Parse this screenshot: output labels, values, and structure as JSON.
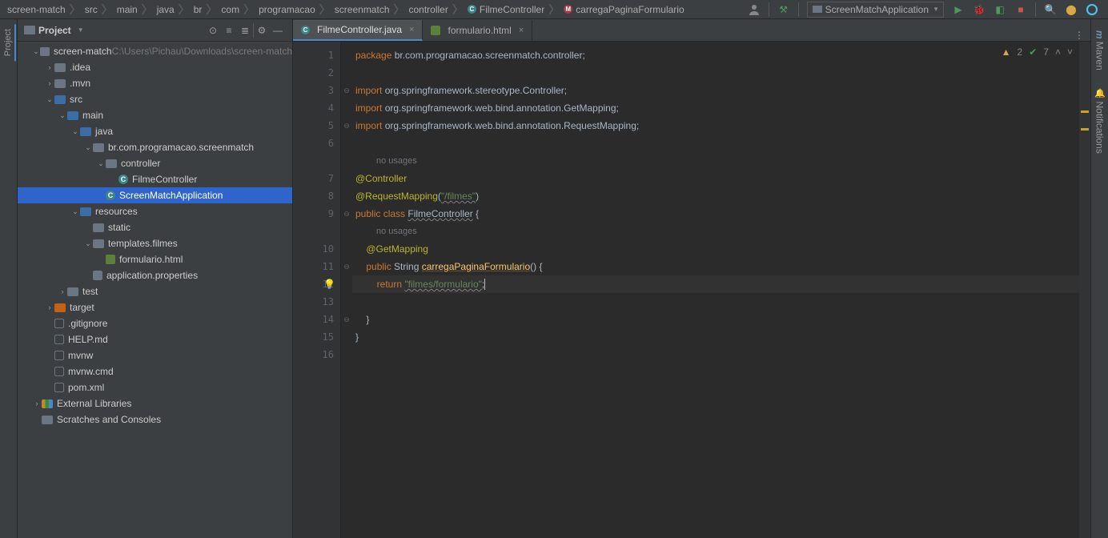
{
  "breadcrumb": [
    "screen-match",
    "src",
    "main",
    "java",
    "br",
    "com",
    "programacao",
    "screenmatch",
    "controller",
    "FilmeController",
    "carregaPaginaFormulario"
  ],
  "breadcrumb_icons": {
    "9": "c",
    "10": "m"
  },
  "run_config": "ScreenMatchApplication",
  "project_label": "Project",
  "tree": [
    {
      "d": 0,
      "a": "v",
      "ic": "folder",
      "t": "screen-match",
      "extra": "C:\\Users\\Pichau\\Downloads\\screen-match"
    },
    {
      "d": 1,
      "a": ">",
      "ic": "folder",
      "t": ".idea"
    },
    {
      "d": 1,
      "a": ">",
      "ic": "folder",
      "t": ".mvn"
    },
    {
      "d": 1,
      "a": "v",
      "ic": "folder-src",
      "t": "src"
    },
    {
      "d": 2,
      "a": "v",
      "ic": "folder-src",
      "t": "main"
    },
    {
      "d": 3,
      "a": "v",
      "ic": "folder-src",
      "t": "java"
    },
    {
      "d": 4,
      "a": "v",
      "ic": "pkg",
      "t": "br.com.programacao.screenmatch"
    },
    {
      "d": 5,
      "a": "v",
      "ic": "pkg",
      "t": "controller"
    },
    {
      "d": 6,
      "a": "",
      "ic": "cfile",
      "ici": "C",
      "t": "FilmeController"
    },
    {
      "d": 5,
      "a": "",
      "ic": "cfile",
      "ici": "C",
      "t": "ScreenMatchApplication",
      "sel": true
    },
    {
      "d": 3,
      "a": "v",
      "ic": "folder-res",
      "t": "resources"
    },
    {
      "d": 4,
      "a": "",
      "ic": "folder",
      "t": "static"
    },
    {
      "d": 4,
      "a": "v",
      "ic": "folder",
      "t": "templates.filmes"
    },
    {
      "d": 5,
      "a": "",
      "ic": "html",
      "t": "formulario.html"
    },
    {
      "d": 4,
      "a": "",
      "ic": "props",
      "t": "application.properties"
    },
    {
      "d": 2,
      "a": ">",
      "ic": "folder",
      "t": "test"
    },
    {
      "d": 1,
      "a": ">",
      "ic": "folder-tgt",
      "t": "target"
    },
    {
      "d": 1,
      "a": "",
      "ic": "file",
      "t": ".gitignore"
    },
    {
      "d": 1,
      "a": "",
      "ic": "file",
      "t": "HELP.md"
    },
    {
      "d": 1,
      "a": "",
      "ic": "file",
      "t": "mvnw"
    },
    {
      "d": 1,
      "a": "",
      "ic": "file",
      "t": "mvnw.cmd"
    },
    {
      "d": 1,
      "a": "",
      "ic": "file",
      "t": "pom.xml"
    },
    {
      "d": 0,
      "a": ">",
      "ic": "lib",
      "t": "External Libraries"
    },
    {
      "d": 0,
      "a": "",
      "ic": "folder",
      "t": "Scratches and Consoles"
    }
  ],
  "tabs": [
    {
      "name": "FilmeController.java",
      "icon": "c",
      "active": true
    },
    {
      "name": "formulario.html",
      "icon": "html",
      "active": false
    }
  ],
  "indicators": {
    "warn": "2",
    "ok": "7"
  },
  "gutter_lines": [
    "1",
    "2",
    "3",
    "4",
    "5",
    "6",
    "",
    "7",
    "8",
    "9",
    "",
    "10",
    "11",
    "12",
    "13",
    "14",
    "15",
    "16"
  ],
  "code": {
    "pkg": "package ",
    "pkg_path": "br.com.programacao.screenmatch.controller",
    "import_kw": "import ",
    "imp1": "org.springframework.stereotype.",
    "imp1b": "Controller",
    "imp2": "org.springframework.web.bind.annotation.",
    "imp2b": "GetMapping",
    "imp3": "org.springframework.web.bind.annotation.",
    "imp3b": "RequestMapping",
    "no_usages": "no usages",
    "anno_ctrl": "@Controller",
    "anno_rm": "@RequestMapping",
    "rm_arg": "\"/filmes\"",
    "cls_decl_pub": "public ",
    "cls_decl_cls": "class ",
    "cls_name": "FilmeController",
    "brace_open": " {",
    "anno_gm": "@GetMapping",
    "m_pub": "public ",
    "m_type": "String ",
    "m_name": "carregaPaginaFormulario",
    "m_sig": "() {",
    "ret": "return ",
    "ret_str": "\"filmes/formulario\"",
    "semi": ";",
    "brace_close": "}"
  },
  "left_tool": "Project",
  "right_tools": [
    "Maven",
    "Notifications"
  ]
}
